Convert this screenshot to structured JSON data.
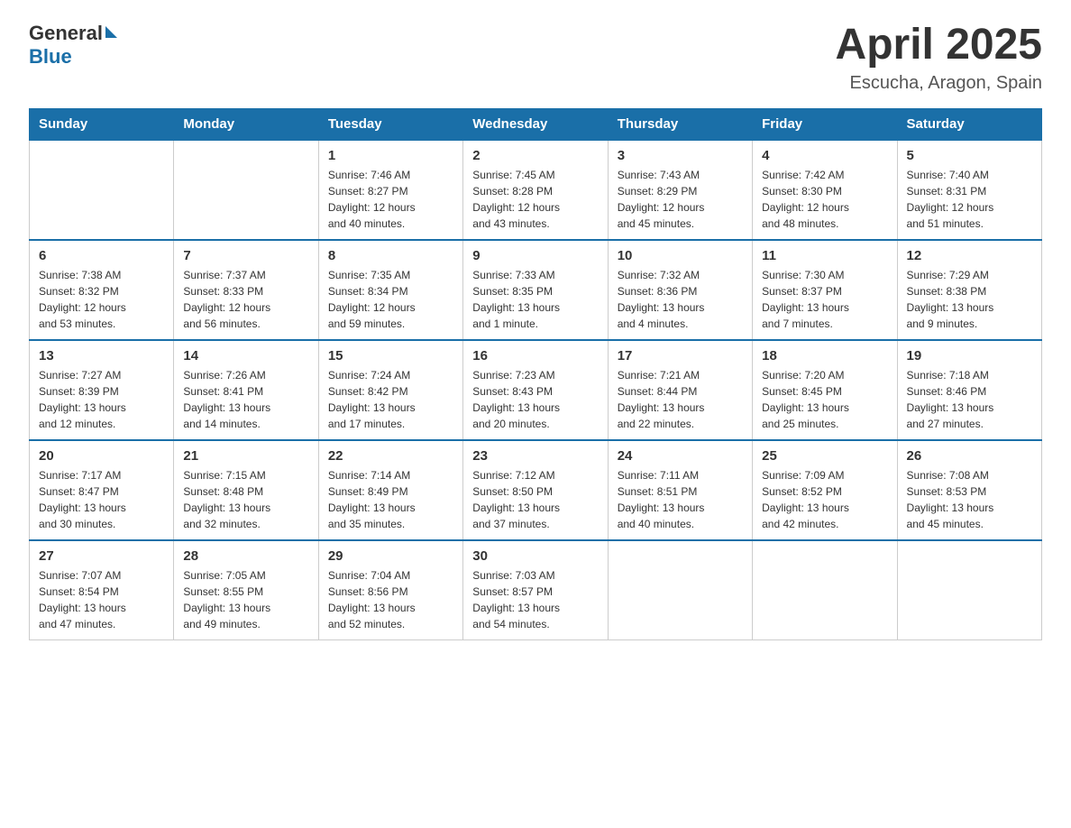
{
  "header": {
    "logo_general": "General",
    "logo_blue": "Blue",
    "title": "April 2025",
    "subtitle": "Escucha, Aragon, Spain"
  },
  "days_of_week": [
    "Sunday",
    "Monday",
    "Tuesday",
    "Wednesday",
    "Thursday",
    "Friday",
    "Saturday"
  ],
  "weeks": [
    [
      {
        "day": "",
        "info": ""
      },
      {
        "day": "",
        "info": ""
      },
      {
        "day": "1",
        "info": "Sunrise: 7:46 AM\nSunset: 8:27 PM\nDaylight: 12 hours\nand 40 minutes."
      },
      {
        "day": "2",
        "info": "Sunrise: 7:45 AM\nSunset: 8:28 PM\nDaylight: 12 hours\nand 43 minutes."
      },
      {
        "day": "3",
        "info": "Sunrise: 7:43 AM\nSunset: 8:29 PM\nDaylight: 12 hours\nand 45 minutes."
      },
      {
        "day": "4",
        "info": "Sunrise: 7:42 AM\nSunset: 8:30 PM\nDaylight: 12 hours\nand 48 minutes."
      },
      {
        "day": "5",
        "info": "Sunrise: 7:40 AM\nSunset: 8:31 PM\nDaylight: 12 hours\nand 51 minutes."
      }
    ],
    [
      {
        "day": "6",
        "info": "Sunrise: 7:38 AM\nSunset: 8:32 PM\nDaylight: 12 hours\nand 53 minutes."
      },
      {
        "day": "7",
        "info": "Sunrise: 7:37 AM\nSunset: 8:33 PM\nDaylight: 12 hours\nand 56 minutes."
      },
      {
        "day": "8",
        "info": "Sunrise: 7:35 AM\nSunset: 8:34 PM\nDaylight: 12 hours\nand 59 minutes."
      },
      {
        "day": "9",
        "info": "Sunrise: 7:33 AM\nSunset: 8:35 PM\nDaylight: 13 hours\nand 1 minute."
      },
      {
        "day": "10",
        "info": "Sunrise: 7:32 AM\nSunset: 8:36 PM\nDaylight: 13 hours\nand 4 minutes."
      },
      {
        "day": "11",
        "info": "Sunrise: 7:30 AM\nSunset: 8:37 PM\nDaylight: 13 hours\nand 7 minutes."
      },
      {
        "day": "12",
        "info": "Sunrise: 7:29 AM\nSunset: 8:38 PM\nDaylight: 13 hours\nand 9 minutes."
      }
    ],
    [
      {
        "day": "13",
        "info": "Sunrise: 7:27 AM\nSunset: 8:39 PM\nDaylight: 13 hours\nand 12 minutes."
      },
      {
        "day": "14",
        "info": "Sunrise: 7:26 AM\nSunset: 8:41 PM\nDaylight: 13 hours\nand 14 minutes."
      },
      {
        "day": "15",
        "info": "Sunrise: 7:24 AM\nSunset: 8:42 PM\nDaylight: 13 hours\nand 17 minutes."
      },
      {
        "day": "16",
        "info": "Sunrise: 7:23 AM\nSunset: 8:43 PM\nDaylight: 13 hours\nand 20 minutes."
      },
      {
        "day": "17",
        "info": "Sunrise: 7:21 AM\nSunset: 8:44 PM\nDaylight: 13 hours\nand 22 minutes."
      },
      {
        "day": "18",
        "info": "Sunrise: 7:20 AM\nSunset: 8:45 PM\nDaylight: 13 hours\nand 25 minutes."
      },
      {
        "day": "19",
        "info": "Sunrise: 7:18 AM\nSunset: 8:46 PM\nDaylight: 13 hours\nand 27 minutes."
      }
    ],
    [
      {
        "day": "20",
        "info": "Sunrise: 7:17 AM\nSunset: 8:47 PM\nDaylight: 13 hours\nand 30 minutes."
      },
      {
        "day": "21",
        "info": "Sunrise: 7:15 AM\nSunset: 8:48 PM\nDaylight: 13 hours\nand 32 minutes."
      },
      {
        "day": "22",
        "info": "Sunrise: 7:14 AM\nSunset: 8:49 PM\nDaylight: 13 hours\nand 35 minutes."
      },
      {
        "day": "23",
        "info": "Sunrise: 7:12 AM\nSunset: 8:50 PM\nDaylight: 13 hours\nand 37 minutes."
      },
      {
        "day": "24",
        "info": "Sunrise: 7:11 AM\nSunset: 8:51 PM\nDaylight: 13 hours\nand 40 minutes."
      },
      {
        "day": "25",
        "info": "Sunrise: 7:09 AM\nSunset: 8:52 PM\nDaylight: 13 hours\nand 42 minutes."
      },
      {
        "day": "26",
        "info": "Sunrise: 7:08 AM\nSunset: 8:53 PM\nDaylight: 13 hours\nand 45 minutes."
      }
    ],
    [
      {
        "day": "27",
        "info": "Sunrise: 7:07 AM\nSunset: 8:54 PM\nDaylight: 13 hours\nand 47 minutes."
      },
      {
        "day": "28",
        "info": "Sunrise: 7:05 AM\nSunset: 8:55 PM\nDaylight: 13 hours\nand 49 minutes."
      },
      {
        "day": "29",
        "info": "Sunrise: 7:04 AM\nSunset: 8:56 PM\nDaylight: 13 hours\nand 52 minutes."
      },
      {
        "day": "30",
        "info": "Sunrise: 7:03 AM\nSunset: 8:57 PM\nDaylight: 13 hours\nand 54 minutes."
      },
      {
        "day": "",
        "info": ""
      },
      {
        "day": "",
        "info": ""
      },
      {
        "day": "",
        "info": ""
      }
    ]
  ]
}
